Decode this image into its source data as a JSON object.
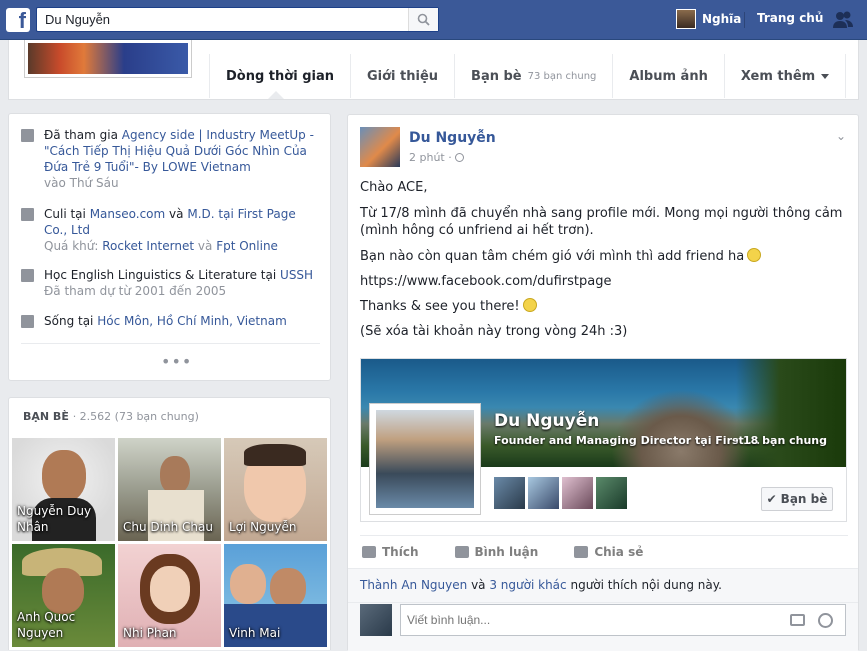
{
  "topbar": {
    "logo": "f",
    "search_value": "Du Nguyễn",
    "user_name": "Nghĩa",
    "home_label": "Trang chủ",
    "search_icon": "search-icon",
    "friends_icon": "friend-requests-icon"
  },
  "tabs": [
    {
      "label": "Dòng thời gian",
      "sub": ""
    },
    {
      "label": "Giới thiệu",
      "sub": ""
    },
    {
      "label": "Bạn bè",
      "sub": "73 bạn chung"
    },
    {
      "label": "Album ảnh",
      "sub": ""
    },
    {
      "label": "Xem thêm",
      "sub": ""
    }
  ],
  "about": {
    "work1": {
      "pre": "Đã tham gia",
      "link": "Agency side | Industry MeetUp - \"Cách Tiếp Thị Hiệu Quả Dưới Góc Nhìn Của Đứa Trẻ 9 Tuổi\"- By LOWE Vietnam",
      "sub": "vào Thứ Sáu"
    },
    "work2": {
      "pre": "Culi tại",
      "link1": "Manseo.com",
      "mid": "và",
      "link2": "M.D. tại First Page Co., Ltd",
      "sub_pre": "Quá khứ:",
      "sub_link1": "Rocket Internet",
      "sub_mid": "và",
      "sub_link2": "Fpt Online"
    },
    "edu": {
      "pre": "Học English Linguistics & Literature tại",
      "link": "USSH",
      "sub": "Đã tham dự từ 2001 đến 2005"
    },
    "home": {
      "pre": "Sống tại",
      "link": "Hóc Môn, Hồ Chí Minh, Vietnam"
    },
    "more": "•••"
  },
  "friends": {
    "heading": "BẠN BÈ",
    "count": "· 2.562 (73 bạn chung)",
    "items": [
      {
        "name": "Nguyễn Duy Nhân"
      },
      {
        "name": "Chu Dinh Chau"
      },
      {
        "name": "Lợi Nguyễn"
      },
      {
        "name": "Anh Quoc Nguyen"
      },
      {
        "name": "Nhi Phan"
      },
      {
        "name": "Vinh Mai"
      }
    ]
  },
  "post": {
    "author": "Du Nguyễn",
    "time": "2 phút ·",
    "lines": [
      "Chào ACE,",
      "Từ 17/8 mình đã chuyển nhà sang profile mới. Mong mọi người thông cảm (mình hông có unfriend ai hết trơn).",
      "Bạn nào còn quan tâm chém gió với mình thì add friend ha",
      "https://www.facebook.com/dufirstpage",
      "Thanks & see you there!",
      "(Sẽ xóa tài khoản này trong vòng 24h :3)"
    ],
    "card": {
      "name": "Du Nguyễn",
      "title": "Founder and Managing Director tại First ...",
      "mutual": "· 18 bạn chung",
      "button": "Bạn bè"
    },
    "actions": {
      "like": "Thích",
      "comment": "Bình luận",
      "share": "Chia sẻ"
    },
    "likes": {
      "name": "Thành An Nguyen",
      "and": "và",
      "others": "3 người khác",
      "rest": "người thích nội dung này."
    },
    "comment_placeholder": "Viết bình luận..."
  }
}
